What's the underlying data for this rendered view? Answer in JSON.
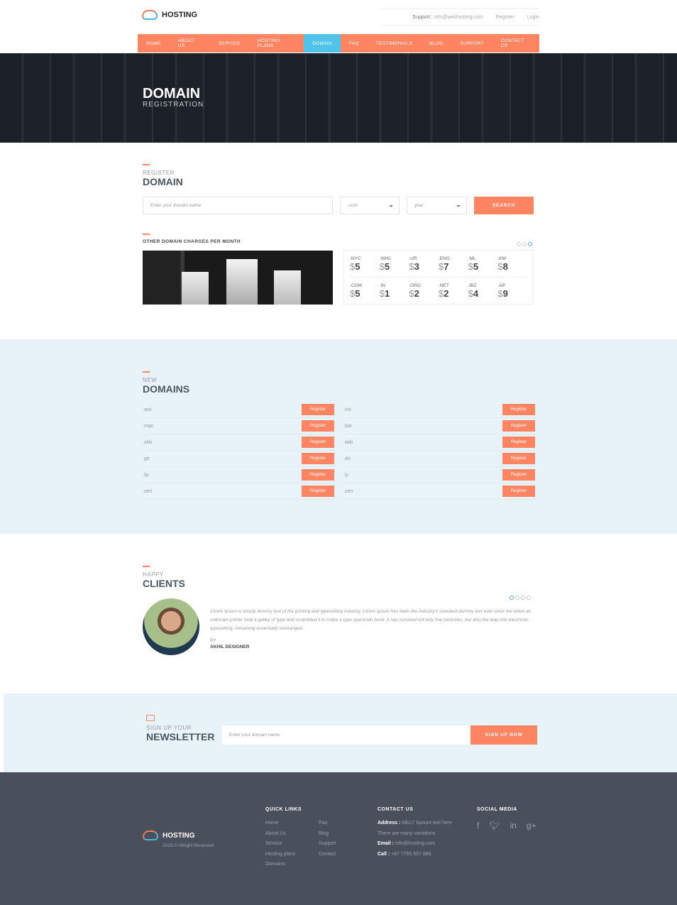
{
  "header": {
    "logo": "HOSTING",
    "support_label": "Support :",
    "support_email": "info@webhosting.com",
    "register": "Register",
    "login": "Login"
  },
  "nav": [
    "HOME",
    "ABOUT US",
    "SERVICE",
    "HOSTING PLANS",
    "DOMAIN",
    "FAQ",
    "TESTIMONIALS",
    "BLOG",
    "SUPPORT",
    "CONTACT US"
  ],
  "nav_active": "DOMAIN",
  "hero": {
    "title": "DOMAIN",
    "subtitle": "REGISTRATION"
  },
  "register": {
    "small": "REGISTER",
    "big": "DOMAIN",
    "placeholder": "Enter your domain name",
    "tld": ".com",
    "period": "year",
    "search": "SEARCH"
  },
  "charges": {
    "title": "OTHER DOMAIN CHARGES PER MONTH",
    "currency": "$",
    "items": [
      {
        "tld": ".NYC",
        "price": "5"
      },
      {
        "tld": ".WIKI",
        "price": "5"
      },
      {
        "tld": ".UR",
        "price": "3"
      },
      {
        "tld": ".ENG",
        "price": "7"
      },
      {
        "tld": ".ML",
        "price": "5"
      },
      {
        "tld": ".KM",
        "price": "8"
      },
      {
        "tld": ".COM",
        "price": "5"
      },
      {
        "tld": ".IN",
        "price": "1"
      },
      {
        "tld": ".ORG",
        "price": "2"
      },
      {
        "tld": ".NET",
        "price": "2"
      },
      {
        "tld": ".BIZ",
        "price": "4"
      },
      {
        "tld": ".AP",
        "price": "9"
      }
    ]
  },
  "new_domains": {
    "small": "NEW",
    "big": "DOMAINS",
    "button": "Register",
    "left": [
      ".ask",
      ".man",
      ".wiki",
      ".git",
      ".lip",
      ".zen"
    ],
    "right": [
      ".ink",
      ".bar",
      ".wiki",
      ".do",
      ".ly",
      ".zen"
    ]
  },
  "clients": {
    "small": "HAPPY",
    "big": "CLIENTS",
    "quote": "Lorem Ipsum is simply dummy text of the printing and typesetting industry. Lorem Ipsum has been the industry's standard dummy text ever since the when an unknown printer took a galley of type and scrambled it to make a type specimen book. It has survived not only five centuries, but also the leap into electronic typesetting, remaining essentially unchanged.",
    "by": "BY",
    "author": "AKHIL DESIGNER"
  },
  "newsletter": {
    "small": "SIGN UP YOUR",
    "big": "NEWSLETTER",
    "placeholder": "Enter your domain name",
    "button": "SIGN UP NOW"
  },
  "footer": {
    "logo": "HOSTING",
    "copyright": "2015 © Allright Reserved",
    "quick_links_title": "QUICK LINKS",
    "links_col1": [
      "Home",
      "About Us",
      "Service",
      "Hosting plans",
      "Domains"
    ],
    "links_col2": [
      "Faq",
      "Blog",
      "Support",
      "Contact"
    ],
    "contact_title": "CONTACT US",
    "address_label": "Address :",
    "address": "Mb17 Spount text here",
    "address2": "There are many variations",
    "email_label": "Email :",
    "email": "info@hosting.com",
    "call_label": "Call :",
    "call": "+87 7765 557 886",
    "social_title": "SOCIAL MEDIA",
    "social": [
      "facebook",
      "twitter",
      "linkedin",
      "google-plus"
    ]
  },
  "colors": {
    "accent": "#ff8462",
    "active": "#4fc3ea",
    "light_bg": "#e8f3f9",
    "footer_bg": "#4a4f5c"
  }
}
